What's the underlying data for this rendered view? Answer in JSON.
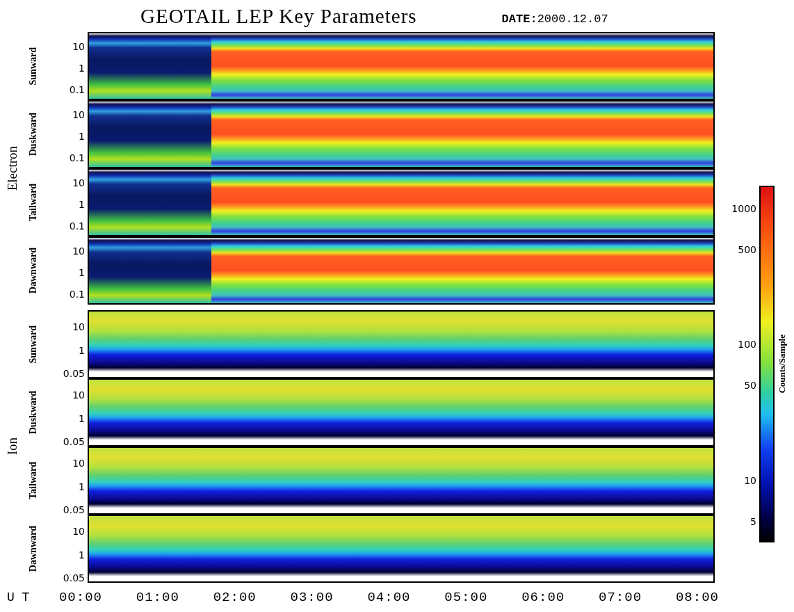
{
  "title": "GEOTAIL LEP Key Parameters",
  "date": {
    "label": "DATE:",
    "value": "2000.12.07"
  },
  "groups": [
    {
      "name": "Electron",
      "kind": "electron",
      "panels": [
        {
          "direction": "Sunward",
          "yticks": [
            "10",
            "1",
            "0.1"
          ]
        },
        {
          "direction": "Duskward",
          "yticks": [
            "10",
            "1",
            "0.1"
          ]
        },
        {
          "direction": "Tailward",
          "yticks": [
            "10",
            "1",
            "0.1"
          ]
        },
        {
          "direction": "Dawnward",
          "yticks": [
            "10",
            "1",
            "0.1"
          ]
        }
      ]
    },
    {
      "name": "Ion",
      "kind": "ion",
      "panels": [
        {
          "direction": "Sunward",
          "yticks": [
            "10",
            "1",
            "0.05"
          ]
        },
        {
          "direction": "Duskward",
          "yticks": [
            "10",
            "1",
            "0.05"
          ]
        },
        {
          "direction": "Tailward",
          "yticks": [
            "10",
            "1",
            "0.05"
          ]
        },
        {
          "direction": "Dawnward",
          "yticks": [
            "10",
            "1",
            "0.05"
          ]
        }
      ]
    }
  ],
  "x_axis": {
    "label": "U T",
    "ticks": [
      "00:00",
      "01:00",
      "02:00",
      "03:00",
      "04:00",
      "05:00",
      "06:00",
      "07:00",
      "08:00"
    ]
  },
  "colorbar": {
    "label": "Counts/Sample",
    "ticks": [
      "1000",
      "500",
      "100",
      "50",
      "10",
      "5"
    ]
  }
}
